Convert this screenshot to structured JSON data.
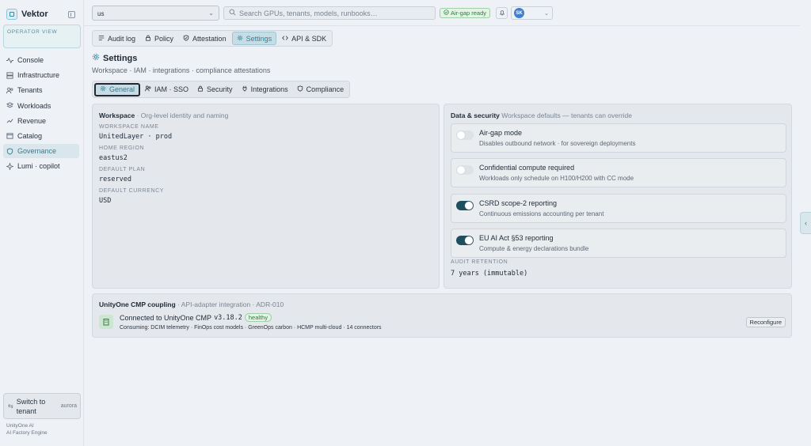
{
  "app": {
    "name": "Vektor",
    "view_label": "OPERATOR VIEW"
  },
  "sidebar": {
    "items": [
      {
        "label": "Console",
        "icon": "activity-icon"
      },
      {
        "label": "Infrastructure",
        "icon": "server-icon"
      },
      {
        "label": "Tenants",
        "icon": "users-icon"
      },
      {
        "label": "Workloads",
        "icon": "layers-icon"
      },
      {
        "label": "Revenue",
        "icon": "trend-icon"
      },
      {
        "label": "Catalog",
        "icon": "box-icon"
      },
      {
        "label": "Governance",
        "icon": "shield-icon",
        "active": true
      },
      {
        "label": "Lumi · copilot",
        "icon": "sparkle-icon"
      }
    ],
    "switch_label": "Switch to tenant",
    "switch_tenant": "aurora",
    "footer_line1": "UnityOne AI",
    "footer_line2": "AI Factory Engine"
  },
  "topbar": {
    "region": "us",
    "search_placeholder": "Search GPUs, tenants, models, runbooks…",
    "airgap_badge": "Air-gap ready",
    "user_initials": "SK"
  },
  "top_tabs": [
    {
      "label": "Audit log",
      "icon": "list-icon"
    },
    {
      "label": "Policy",
      "icon": "lock-icon"
    },
    {
      "label": "Attestation",
      "icon": "shield-check-icon"
    },
    {
      "label": "Settings",
      "icon": "gear-icon",
      "active": true
    },
    {
      "label": "API & SDK",
      "icon": "code-icon"
    }
  ],
  "page": {
    "title": "Settings",
    "subtitle": "Workspace · IAM · integrations · compliance attestations"
  },
  "sub_tabs": [
    {
      "label": "General",
      "icon": "gear-icon",
      "active": true
    },
    {
      "label": "IAM · SSO",
      "icon": "users-icon"
    },
    {
      "label": "Security",
      "icon": "lock-icon"
    },
    {
      "label": "Integrations",
      "icon": "plug-icon"
    },
    {
      "label": "Compliance",
      "icon": "shield-icon"
    }
  ],
  "workspace": {
    "title": "Workspace",
    "subtitle": "Org-level identity and naming",
    "fields": [
      {
        "label": "WORKSPACE NAME",
        "value": "UnitedLayer · prod"
      },
      {
        "label": "HOME REGION",
        "value": "eastus2"
      },
      {
        "label": "DEFAULT PLAN",
        "value": "reserved"
      },
      {
        "label": "DEFAULT CURRENCY",
        "value": "USD"
      }
    ]
  },
  "security": {
    "title": "Data & security",
    "subtitle": "Workspace defaults — tenants can override",
    "toggles": [
      {
        "title": "Air-gap mode",
        "desc": "Disables outbound network · for sovereign deployments",
        "on": false
      },
      {
        "title": "Confidential compute required",
        "desc": "Workloads only schedule on H100/H200 with CC mode",
        "on": false
      },
      {
        "title": "CSRD scope-2 reporting",
        "desc": "Continuous emissions accounting per tenant",
        "on": true
      },
      {
        "title": "EU AI Act §53 reporting",
        "desc": "Compute & energy declarations bundle",
        "on": true
      }
    ],
    "retention_label": "AUDIT RETENTION",
    "retention_value": "7 years (immutable)"
  },
  "unity": {
    "title": "UnityOne CMP coupling",
    "subtitle": "API-adapter integration · ADR-010",
    "connected_text": "Connected to UnityOne CMP",
    "version": "v3.18.2",
    "status": "healthy",
    "consuming": "Consuming: DCIM telemetry · FinOps cost models · GreenOps carbon · HCMP multi-cloud · 14 connectors",
    "reconfigure_label": "Reconfigure"
  },
  "colors": {
    "accent": "#2d7f98",
    "toggle_on": "#1f4f5e",
    "healthy": "#2f7d3d"
  }
}
